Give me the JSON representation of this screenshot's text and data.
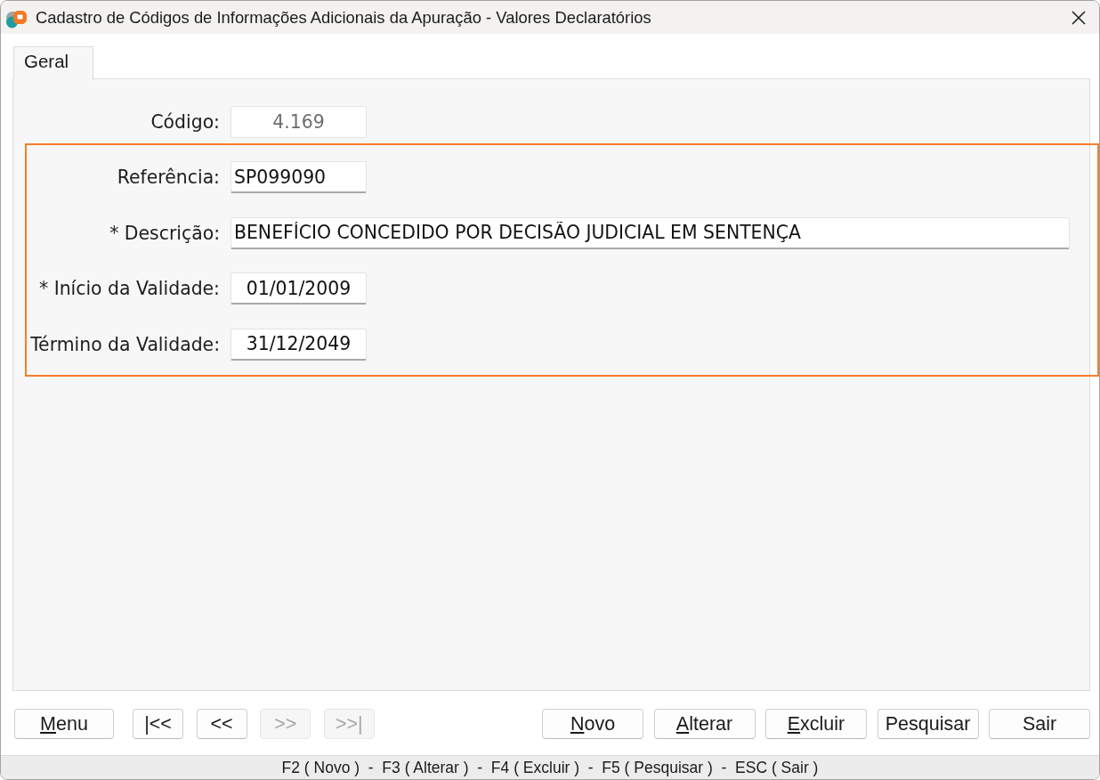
{
  "window": {
    "title": "Cadastro de Códigos de Informações Adicionais da Apuração - Valores Declaratórios"
  },
  "tabs": [
    {
      "label": "Geral",
      "selected": true
    }
  ],
  "form": {
    "sections": [
      {
        "highlighted": false,
        "fields": [
          {
            "label": "Código:",
            "value": "4.169",
            "kind": "code",
            "disabled": true
          }
        ]
      },
      {
        "highlighted": true,
        "fields": [
          {
            "label": "Referência:",
            "value": "SP099090",
            "kind": "reference",
            "disabled": false
          },
          {
            "label": "* Descrição:",
            "value": "BENEFÍCIO CONCEDIDO POR DECISÃO JUDICIAL EM SENTENÇA",
            "kind": "description",
            "disabled": false
          },
          {
            "label": "* Início da Validade:",
            "value": "01/01/2009",
            "kind": "date",
            "disabled": false
          },
          {
            "label": "Término da Validade:",
            "value": "31/12/2049",
            "kind": "date",
            "disabled": false
          }
        ]
      }
    ]
  },
  "footer": {
    "menu_button": {
      "label": "Menu",
      "mnemonic": true,
      "disabled": false
    },
    "nav_buttons": [
      {
        "label": "|<<",
        "disabled": false
      },
      {
        "label": "<<",
        "disabled": false
      },
      {
        "label": ">>",
        "disabled": true
      },
      {
        "label": ">>|",
        "disabled": true
      }
    ],
    "action_buttons": [
      {
        "label": "Novo",
        "mnemonic": true,
        "disabled": false
      },
      {
        "label": "Alterar",
        "mnemonic": true,
        "disabled": false
      },
      {
        "label": "Excluir",
        "mnemonic": true,
        "disabled": false
      },
      {
        "label": "Pesquisar",
        "mnemonic": false,
        "disabled": false
      },
      {
        "label": "Sair",
        "mnemonic": false,
        "disabled": false
      }
    ]
  },
  "status_bar": {
    "text": "F2 ( Novo )  -  F3 ( Alterar )  -  F4 ( Excluir )  -  F5 ( Pesquisar )  -  ESC ( Sair )"
  }
}
